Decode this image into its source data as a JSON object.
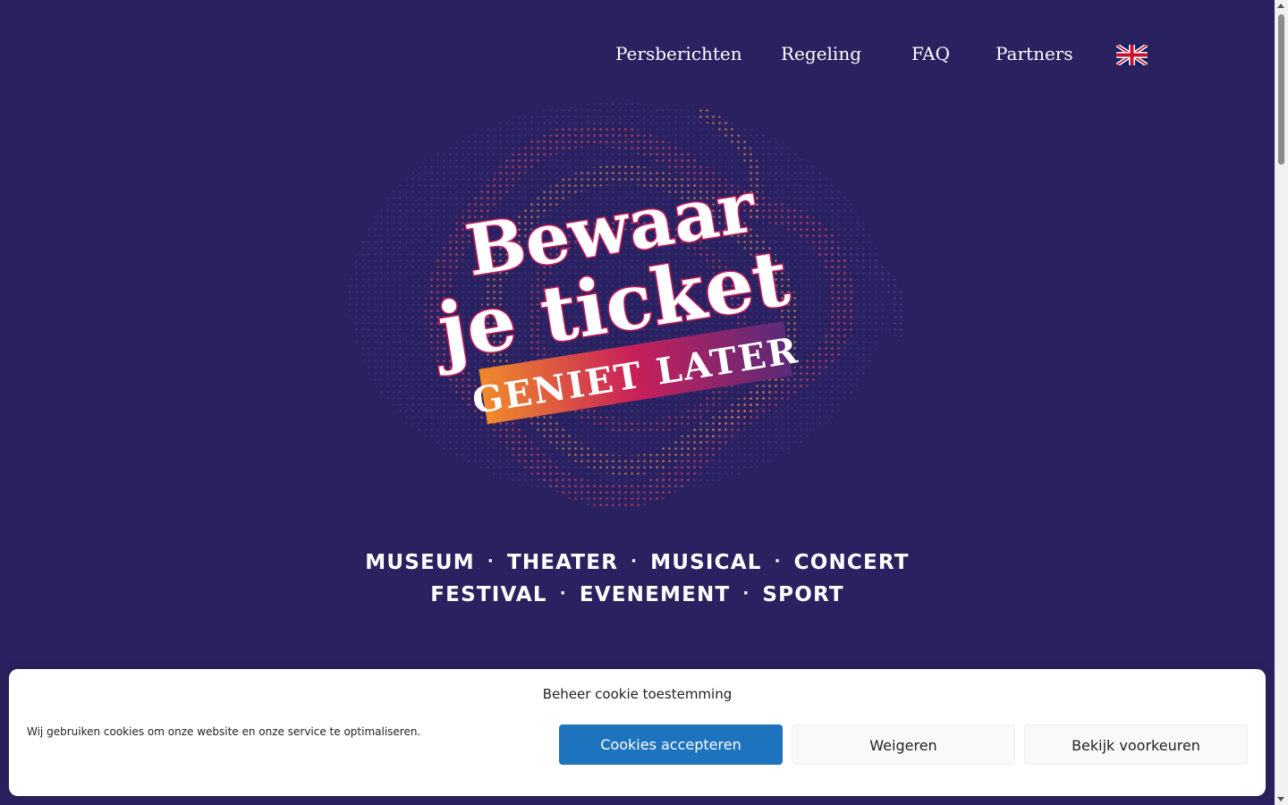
{
  "nav": {
    "items": [
      {
        "label": "Persberichten"
      },
      {
        "label": "Regeling"
      },
      {
        "label": "FAQ"
      },
      {
        "label": "Partners"
      }
    ],
    "language_icon": "uk-flag-icon"
  },
  "hero": {
    "logo_line1": "Bewaar",
    "logo_line2": "je ticket",
    "logo_banner": "GENIET LATER"
  },
  "categories": {
    "row1": [
      "MUSEUM",
      "THEATER",
      "MUSICAL",
      "CONCERT"
    ],
    "row2": [
      "FESTIVAL",
      "EVENEMENT",
      "SPORT"
    ],
    "separator": "·"
  },
  "cookie_banner": {
    "title": "Beheer cookie toestemming",
    "message": "Wij gebruiken cookies om onze website en onze service te optimaliseren.",
    "accept_label": "Cookies accepteren",
    "deny_label": "Weigeren",
    "preferences_label": "Bekijk voorkeuren"
  },
  "colors": {
    "background": "#2a2260",
    "accept_button": "#1e73be",
    "logo_gradient_start": "#f08a2a",
    "logo_gradient_end": "#5a2a7a"
  }
}
